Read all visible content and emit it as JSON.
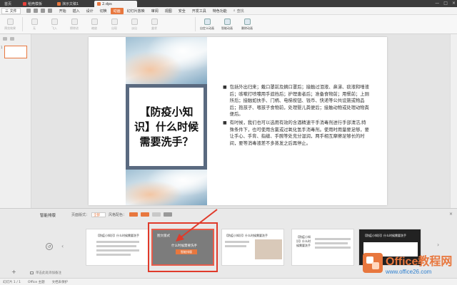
{
  "titlebar": {
    "tabs": [
      {
        "label": "首页",
        "color": "#2d7fcf",
        "active": false
      },
      {
        "label": "稻壳模板",
        "color": "#e8413a",
        "active": false
      },
      {
        "label": "演示文稿1",
        "color": "#e8773e",
        "active": false
      },
      {
        "label": "2.dps",
        "color": "#e8773e",
        "active": true
      }
    ],
    "controls": [
      "—",
      "□",
      "×"
    ]
  },
  "menubar": {
    "file": "三 文件",
    "items": [
      "开始",
      "插入",
      "设计",
      "切换",
      "动画",
      "幻灯片放映",
      "审阅",
      "视图",
      "安全",
      "开发工具",
      "特色功能"
    ],
    "active_index": 4,
    "search": "查找"
  },
  "ribbon": {
    "buttons": [
      "预览效果",
      "无",
      "飞入",
      "擦除进",
      "缩放",
      "出现",
      "淡出",
      "盒状",
      "自定义动画",
      "智能动画",
      "删除动画"
    ]
  },
  "slide": {
    "title": "【防疫小知识】什么时候需要洗手？",
    "bullets": [
      "包括外出归来；戴口罩前及摘口罩后；接触过泪液、鼻涕、痰液和唾液后；咳嗽打喷嚏用手遮挡后；护理患者后；准备食物前；用餐前；上厕所后；接触如扶手、门柄、电梯按钮、钱币、快递等公共设施或物品后；抱孩子、喂孩子食物前，处理婴儿粪便后；接触动物或处理动物粪便后。",
      "有时候，我们也可以选用有效的含酒精速干手消毒剂进行手部清洁,特殊条件下，也可使用含氯或过氧化氢手消毒剂。使用时用量要足够，要让手心、手背、指缝、手腕等处充分湿润，两手相互摩擦足够长的时间，要等消毒液差不多蒸发之后再停止。"
    ]
  },
  "thumbnail": {
    "number": "1"
  },
  "bottom_panel": {
    "title": "智能排版",
    "opt1_label": "页面版式：",
    "opt1_value": "全部",
    "opt2_label": "风格配色：",
    "swatches": [
      "#e8773e",
      "#e8773e",
      "#c8c8c8",
      "#999999"
    ],
    "close": "×",
    "templates": [
      {
        "title": "【防疫小知识】什么时候需要洗手"
      },
      {
        "title": "图文版式",
        "subtitle": "什么时候需要洗手",
        "button": "智能排版"
      },
      {
        "title": "【防疫小知识】什么时候需要洗手"
      },
      {
        "title": "【防疫小知识】什么时候需要洗手"
      },
      {
        "title": "【防疫小知识】什么时候需要洗手"
      }
    ]
  },
  "statusbar": {
    "slide_count": "幻灯片 1 / 1",
    "theme": "Office 主题",
    "check": "文档未保护",
    "notes": "单击此处添加备注",
    "add": "+"
  },
  "watermark": {
    "line1": "Office教程网",
    "line2": "www.office26.com"
  }
}
